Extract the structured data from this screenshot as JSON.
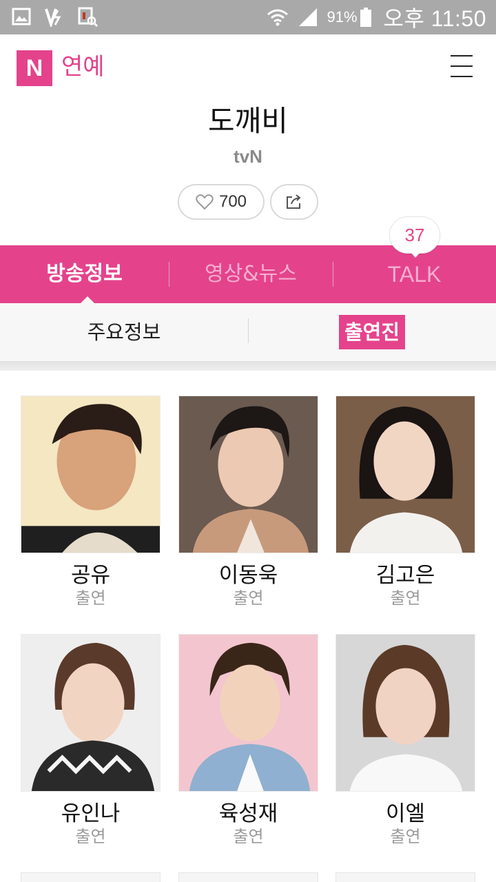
{
  "status_bar": {
    "battery_pct": "91%",
    "clock": "오후 11:50",
    "icons": [
      "gallery-icon",
      "vpn-icon",
      "screenshot-search-icon",
      "wifi-icon",
      "signal-icon",
      "battery-icon"
    ]
  },
  "header": {
    "logo_letter": "N",
    "logo_text": "연예",
    "menu_icon": "hamburger-menu-icon"
  },
  "show": {
    "title": "도깨비",
    "channel": "tvN",
    "likes": "700"
  },
  "tabs": [
    {
      "label": "방송정보",
      "active": true
    },
    {
      "label": "영상&뉴스",
      "active": false
    },
    {
      "label": "TALK",
      "active": false,
      "badge": "37"
    }
  ],
  "subtabs": [
    {
      "label": "주요정보",
      "active": false
    },
    {
      "label": "출연진",
      "active": true
    }
  ],
  "cast": [
    {
      "name": "공유",
      "role": "출연"
    },
    {
      "name": "이동욱",
      "role": "출연"
    },
    {
      "name": "김고은",
      "role": "출연"
    },
    {
      "name": "유인나",
      "role": "출연"
    },
    {
      "name": "육성재",
      "role": "출연"
    },
    {
      "name": "이엘",
      "role": "출연"
    }
  ],
  "colors": {
    "accent": "#e4438c",
    "status_bar": "#a9a9a9"
  }
}
